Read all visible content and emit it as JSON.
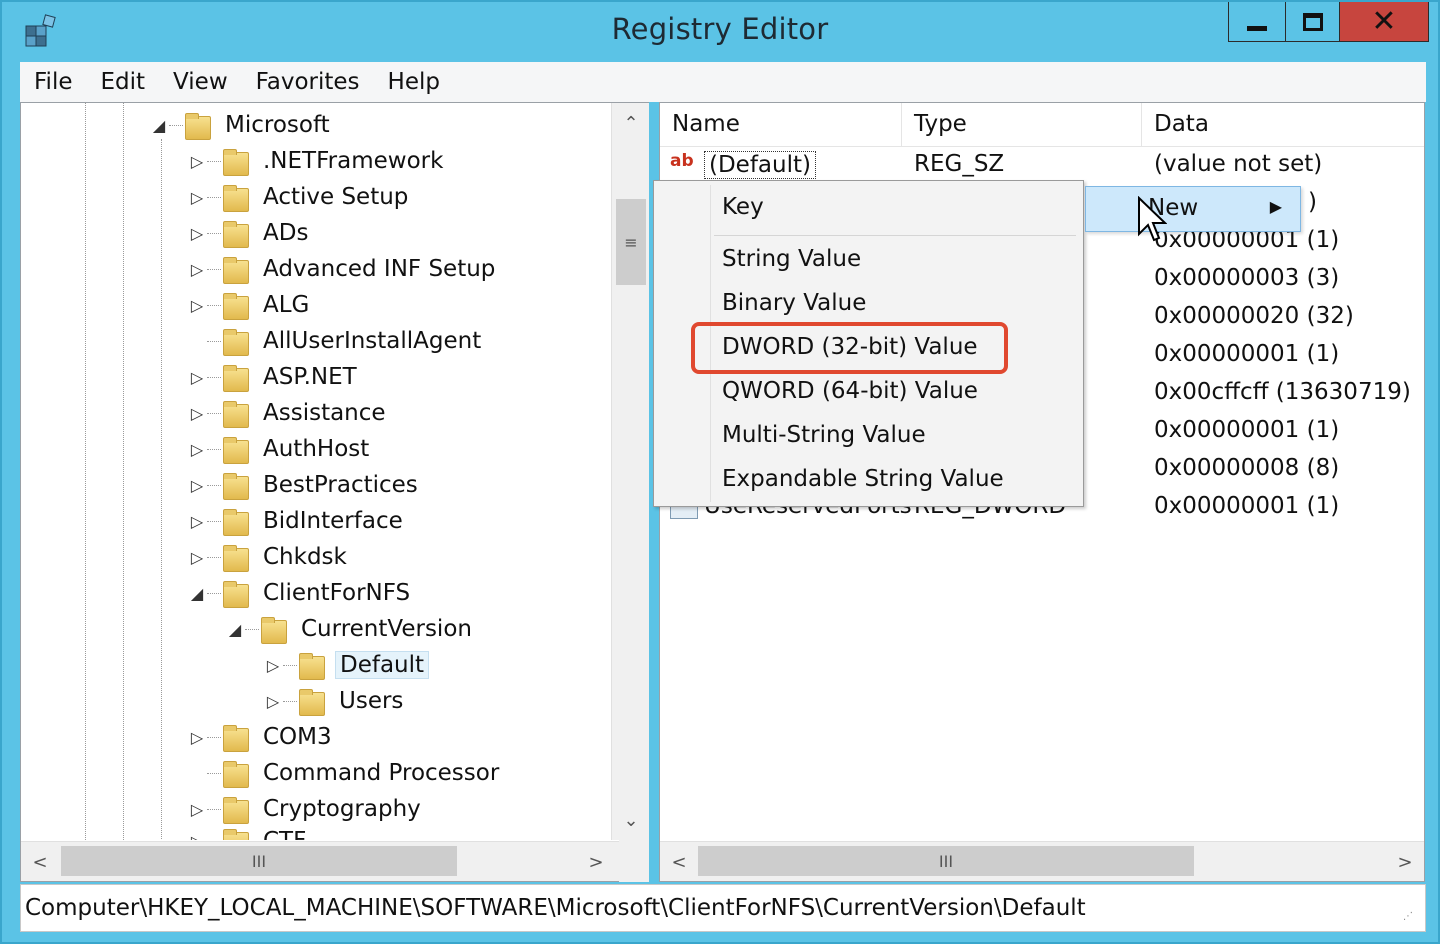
{
  "window": {
    "title": "Registry Editor",
    "close_glyph": "✕"
  },
  "menubar": [
    "File",
    "Edit",
    "View",
    "Favorites",
    "Help"
  ],
  "tree": {
    "items": [
      {
        "label": "Microsoft",
        "expander": "◢"
      },
      {
        "label": ".NETFramework",
        "expander": "▷"
      },
      {
        "label": "Active Setup",
        "expander": "▷"
      },
      {
        "label": "ADs",
        "expander": "▷"
      },
      {
        "label": "Advanced INF Setup",
        "expander": "▷"
      },
      {
        "label": "ALG",
        "expander": "▷"
      },
      {
        "label": "AllUserInstallAgent",
        "expander": ""
      },
      {
        "label": "ASP.NET",
        "expander": "▷"
      },
      {
        "label": "Assistance",
        "expander": "▷"
      },
      {
        "label": "AuthHost",
        "expander": "▷"
      },
      {
        "label": "BestPractices",
        "expander": "▷"
      },
      {
        "label": "BidInterface",
        "expander": "▷"
      },
      {
        "label": "Chkdsk",
        "expander": "▷"
      },
      {
        "label": "ClientForNFS",
        "expander": "◢"
      },
      {
        "label": "CurrentVersion",
        "expander": "◢"
      },
      {
        "label": "Default",
        "expander": "▷",
        "selected": true
      },
      {
        "label": "Users",
        "expander": "▷"
      },
      {
        "label": "COM3",
        "expander": "▷"
      },
      {
        "label": "Command Processor",
        "expander": ""
      },
      {
        "label": "Cryptography",
        "expander": "▷"
      },
      {
        "label": "CTF",
        "expander": "▷"
      }
    ]
  },
  "scroll": {
    "up": "⌃",
    "down": "⌄",
    "left": "<",
    "right": ">",
    "grip": "≡",
    "hgrip": "III"
  },
  "list": {
    "columns": [
      "Name",
      "Type",
      "Data"
    ],
    "rows": [
      {
        "name": "(Default)",
        "type": "REG_SZ",
        "data": "(value not set)",
        "icon": "ab"
      },
      {
        "name": "",
        "type": "",
        "data": ")",
        "icon": ""
      },
      {
        "name": "",
        "type": "",
        "data": "0x00000001 (1)",
        "icon": ""
      },
      {
        "name": "",
        "type": "",
        "data": "0x00000003 (3)",
        "icon": ""
      },
      {
        "name": "",
        "type": "",
        "data": "0x00000020 (32)",
        "icon": ""
      },
      {
        "name": "",
        "type": "",
        "data": "0x00000001 (1)",
        "icon": ""
      },
      {
        "name": "",
        "type": "",
        "data": "0x00cffcff (13630719)",
        "icon": ""
      },
      {
        "name": "",
        "type": "",
        "data": "0x00000001 (1)",
        "icon": ""
      },
      {
        "name": "",
        "type": "",
        "data": "0x00000008 (8)",
        "icon": ""
      },
      {
        "name": "UseReservedPorts",
        "type": "REG_DWORD",
        "data": "0x00000001 (1)",
        "icon": ""
      }
    ]
  },
  "context_menu": {
    "parent": {
      "label": "New",
      "arrow": "▶"
    },
    "items": [
      "Key",
      "String Value",
      "Binary Value",
      "DWORD (32-bit) Value",
      "QWORD (64-bit) Value",
      "Multi-String Value",
      "Expandable String Value"
    ]
  },
  "statusbar": {
    "path": "Computer\\HKEY_LOCAL_MACHINE\\SOFTWARE\\Microsoft\\ClientForNFS\\CurrentVersion\\Default"
  },
  "colors": {
    "highlight": "#e0482f",
    "title_bar": "#5bc3e6",
    "close": "#c7453e"
  }
}
